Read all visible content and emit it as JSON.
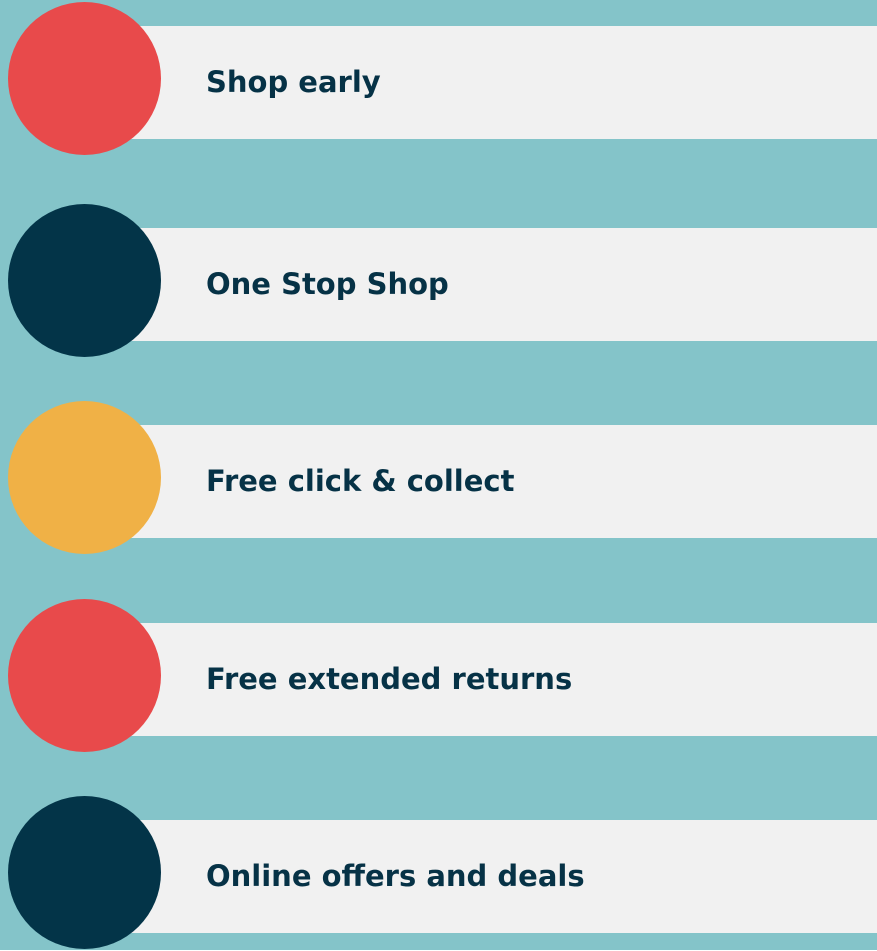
{
  "colors": {
    "background": "#84c4c9",
    "card": "#f1f1f1",
    "text": "#063246",
    "red": "#e84a4b",
    "navy": "#033448",
    "yellow": "#f0b146"
  },
  "items": [
    {
      "label": "Shop early",
      "color": "#e84a4b"
    },
    {
      "label": "One Stop Shop",
      "color": "#033448"
    },
    {
      "label": "Free click & collect",
      "color": "#f0b146"
    },
    {
      "label": "Free extended returns",
      "color": "#e84a4b"
    },
    {
      "label": "Online offers and deals",
      "color": "#033448"
    }
  ]
}
